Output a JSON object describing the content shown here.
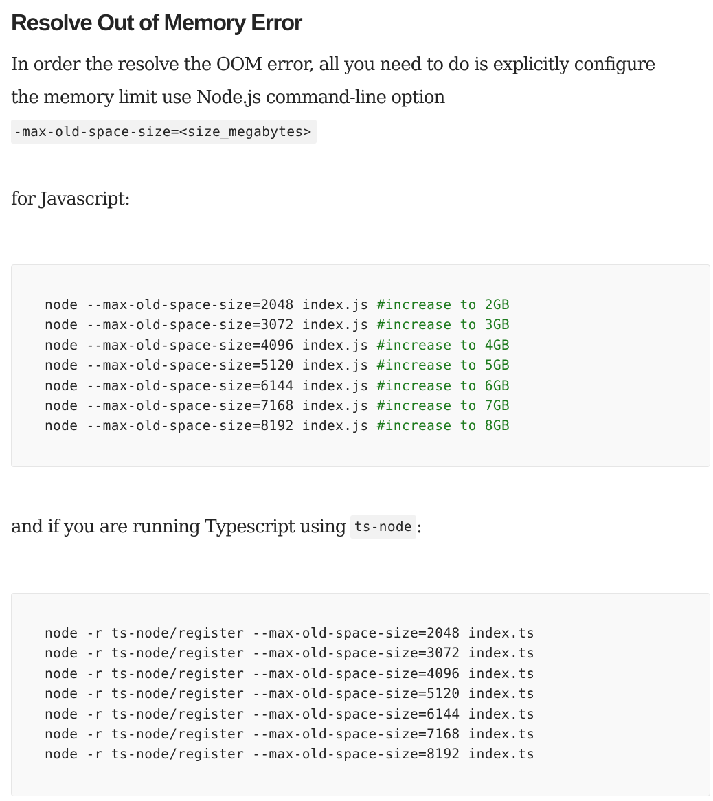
{
  "article": {
    "heading": "Resolve Out of Memory Error",
    "intro_line1": "In order the resolve the OOM error, all you need to do is explicitly configure",
    "intro_line2": "the memory limit use Node.js command-line option",
    "option_code": "-max-old-space-size=<size_megabytes>",
    "js_label": "for Javascript:",
    "ts_label_before": "and if you are running Typescript using",
    "ts_label_code": "ts-node",
    "ts_label_after": ":"
  },
  "js_block": {
    "lines": [
      {
        "code": "node --max-old-space-size=2048 index.js ",
        "comment": "#increase to 2GB"
      },
      {
        "code": "node --max-old-space-size=3072 index.js ",
        "comment": "#increase to 3GB"
      },
      {
        "code": "node --max-old-space-size=4096 index.js ",
        "comment": "#increase to 4GB"
      },
      {
        "code": "node --max-old-space-size=5120 index.js ",
        "comment": "#increase to 5GB"
      },
      {
        "code": "node --max-old-space-size=6144 index.js ",
        "comment": "#increase to 6GB"
      },
      {
        "code": "node --max-old-space-size=7168 index.js ",
        "comment": "#increase to 7GB"
      },
      {
        "code": "node --max-old-space-size=8192 index.js ",
        "comment": "#increase to 8GB"
      }
    ]
  },
  "ts_block": {
    "lines": [
      "node -r ts-node/register --max-old-space-size=2048 index.ts",
      "node -r ts-node/register --max-old-space-size=3072 index.ts",
      "node -r ts-node/register --max-old-space-size=4096 index.ts",
      "node -r ts-node/register --max-old-space-size=5120 index.ts",
      "node -r ts-node/register --max-old-space-size=6144 index.ts",
      "node -r ts-node/register --max-old-space-size=7168 index.ts",
      "node -r ts-node/register --max-old-space-size=8192 index.ts"
    ]
  },
  "colors": {
    "text": "#242424",
    "comment": "#1c7a1c",
    "code_background": "#f9f9f9",
    "inline_code_background": "#f2f2f2"
  }
}
